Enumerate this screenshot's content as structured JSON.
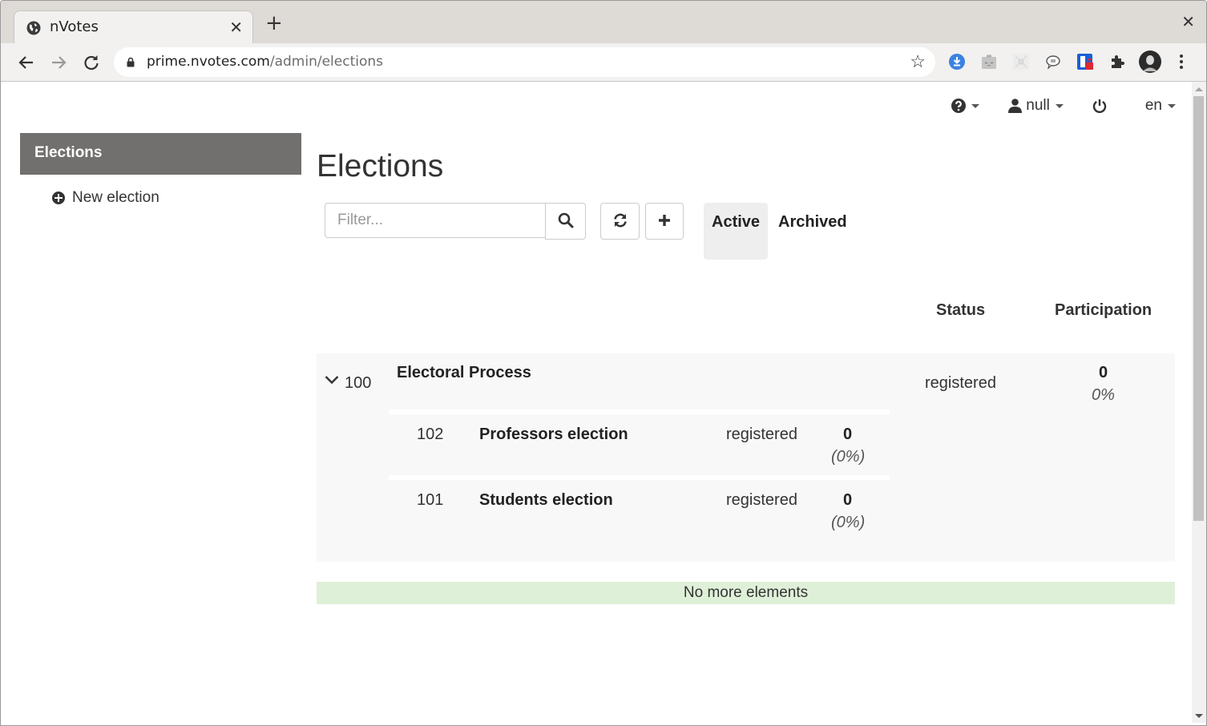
{
  "browser": {
    "tab_title": "nVotes",
    "url_host": "prime.nvotes.com",
    "url_path": "/admin/elections",
    "extensions": [
      "download-extension-icon",
      "sleepy-extension-icon",
      "network-extension-icon",
      "chat-extension-icon",
      "password-manager-extension-icon",
      "extensions-puzzle-icon"
    ]
  },
  "topnav": {
    "user_label": "null",
    "language_label": "en"
  },
  "sidebar": {
    "header": "Elections",
    "new_election_label": "New election"
  },
  "main": {
    "title": "Elections",
    "filter_placeholder": "Filter...",
    "tabs": [
      {
        "label": "Active",
        "active": true
      },
      {
        "label": "Archived",
        "active": false
      }
    ],
    "columns": {
      "status": "Status",
      "participation": "Participation"
    },
    "parent": {
      "id": "100",
      "name": "Electoral Process",
      "status": "registered",
      "votes": "0",
      "percent": "0%"
    },
    "children": [
      {
        "id": "102",
        "name": "Professors election",
        "status": "registered",
        "votes": "0",
        "percent": "(0%)"
      },
      {
        "id": "101",
        "name": "Students election",
        "status": "registered",
        "votes": "0",
        "percent": "(0%)"
      }
    ],
    "footer_message": "No more elements"
  }
}
